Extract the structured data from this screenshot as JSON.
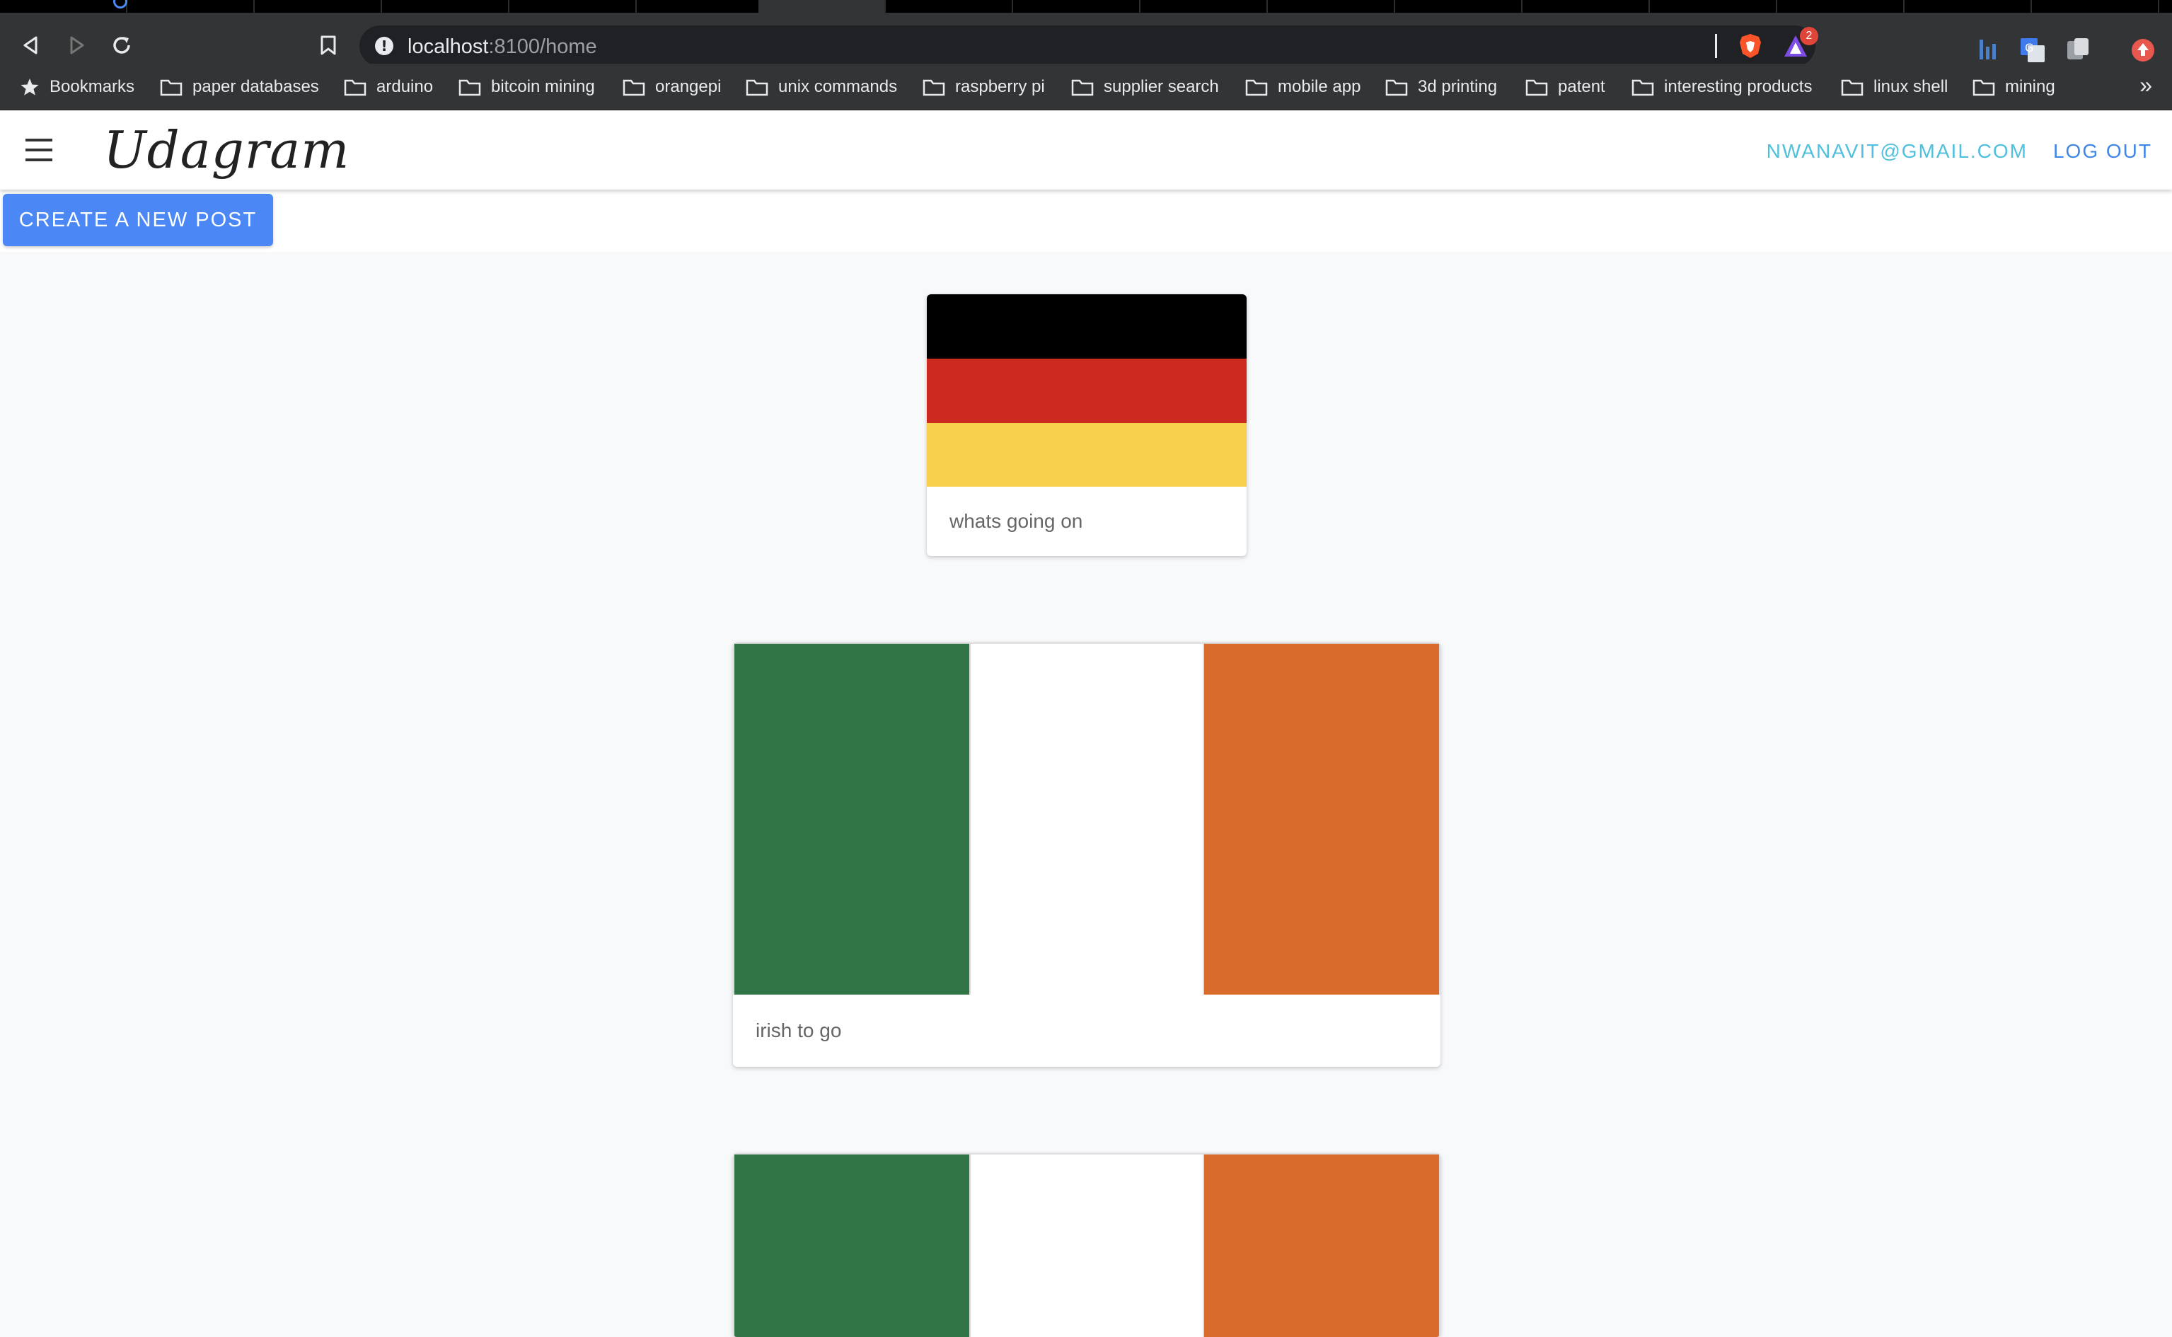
{
  "browser": {
    "url_host": "localhost",
    "url_path": ":8100/home",
    "rewards_count": "2",
    "bookmarks": [
      {
        "label": "Bookmarks",
        "icon": "star-icon"
      },
      {
        "label": "paper databases",
        "icon": "folder-icon"
      },
      {
        "label": "arduino",
        "icon": "folder-icon"
      },
      {
        "label": "bitcoin mining",
        "icon": "folder-icon"
      },
      {
        "label": "orangepi",
        "icon": "folder-icon"
      },
      {
        "label": "unix commands",
        "icon": "folder-icon"
      },
      {
        "label": "raspberry pi",
        "icon": "folder-icon"
      },
      {
        "label": "supplier search",
        "icon": "folder-icon"
      },
      {
        "label": "mobile app",
        "icon": "folder-icon"
      },
      {
        "label": "3d printing",
        "icon": "folder-icon"
      },
      {
        "label": "patent",
        "icon": "folder-icon"
      },
      {
        "label": "interesting products",
        "icon": "folder-icon"
      },
      {
        "label": "linux shell",
        "icon": "folder-icon"
      },
      {
        "label": "mining",
        "icon": "folder-icon"
      }
    ],
    "more_bookmarks": "»"
  },
  "app": {
    "logo": "Udagram",
    "user_email": "NWANAVIT@GMAIL.COM",
    "logout_label": "LOG OUT",
    "create_post_label": "CREATE A NEW POST"
  },
  "feed": {
    "posts": [
      {
        "caption": "whats going on",
        "image": "germany-flag",
        "colors": [
          "#000000",
          "#cc2a1f",
          "#f7cf4b"
        ]
      },
      {
        "caption": "irish to go",
        "image": "ireland-flag",
        "colors": [
          "#317445",
          "#ffffff",
          "#d96b2d"
        ]
      },
      {
        "caption": "",
        "image": "ireland-flag",
        "colors": [
          "#317445",
          "#ffffff",
          "#d96b2d"
        ]
      }
    ]
  },
  "colors": {
    "accent": "#4b88f5",
    "email": "#4fc0dd",
    "logout": "#3f86e8",
    "page_bg": "#f8f9fb"
  }
}
